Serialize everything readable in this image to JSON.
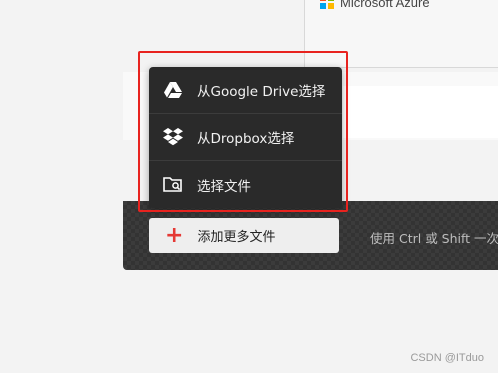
{
  "top_card": {
    "azure_label": "Microsoft Azure",
    "azure_icon": "microsoft-logo-icon",
    "ms_colors": [
      "#f25022",
      "#7fba00",
      "#00a4ef",
      "#ffb900"
    ]
  },
  "menu": {
    "items": [
      {
        "label": "从Google Drive选择",
        "icon": "google-drive-icon"
      },
      {
        "label": "从Dropbox选择",
        "icon": "dropbox-icon"
      },
      {
        "label": "选择文件",
        "icon": "folder-search-icon"
      }
    ]
  },
  "bottom_bar": {
    "add_button_label": "添加更多文件",
    "add_icon": "plus-icon",
    "hint_text": "使用 Ctrl 或 Shift 一次选",
    "accent": "#e53935"
  },
  "annotation_color": "#e8231f",
  "watermark": "CSDN @ITduo"
}
